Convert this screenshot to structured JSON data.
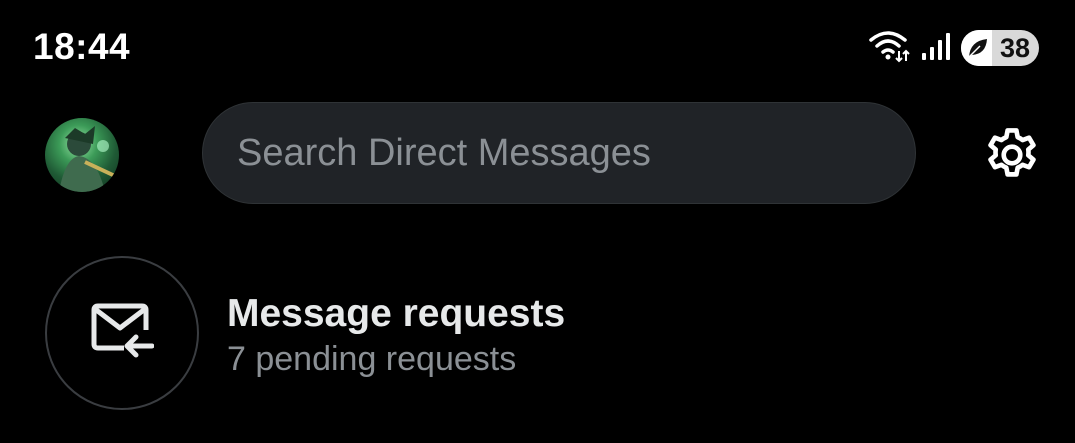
{
  "status_bar": {
    "time": "18:44",
    "battery_level": "38",
    "icons": [
      "wifi-icon",
      "signal-icon",
      "battery-saver-leaf-icon"
    ]
  },
  "header": {
    "search": {
      "placeholder": "Search Direct Messages"
    },
    "settings_icon": "gear-icon"
  },
  "message_requests": {
    "title": "Message requests",
    "subtitle": "7 pending requests",
    "icon": "envelope-incoming-icon"
  }
}
